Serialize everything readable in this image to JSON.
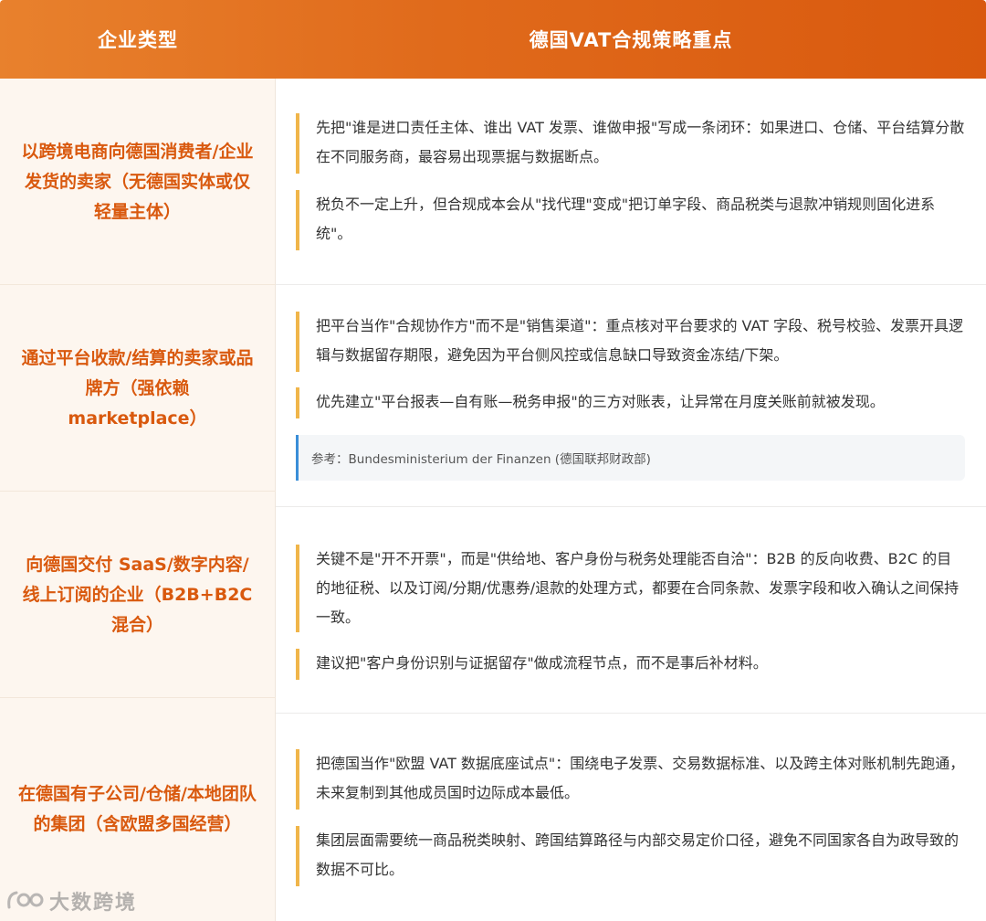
{
  "header": {
    "col1": "企业类型",
    "col2": "德国VAT合规策略重点"
  },
  "rows": [
    {
      "type": "以跨境电商向德国消费者/企业发货的卖家（无德国实体或仅轻量主体）",
      "points": [
        "先把\"谁是进口责任主体、谁出 VAT 发票、谁做申报\"写成一条闭环：如果进口、仓储、平台结算分散在不同服务商，最容易出现票据与数据断点。",
        "税负不一定上升，但合规成本会从\"找代理\"变成\"把订单字段、商品税类与退款冲销规则固化进系统\"。"
      ]
    },
    {
      "type": "通过平台收款/结算的卖家或品牌方（强依赖 marketplace）",
      "points": [
        "把平台当作\"合规协作方\"而不是\"销售渠道\"：重点核对平台要求的 VAT 字段、税号校验、发票开具逻辑与数据留存期限，避免因为平台侧风控或信息缺口导致资金冻结/下架。",
        "优先建立\"平台报表—自有账—税务申报\"的三方对账表，让异常在月度关账前就被发现。"
      ],
      "reference": "参考：Bundesministerium der Finanzen (德国联邦财政部)"
    },
    {
      "type": "向德国交付 SaaS/数字内容/线上订阅的企业（B2B+B2C混合）",
      "points": [
        "关键不是\"开不开票\"，而是\"供给地、客户身份与税务处理能否自洽\"：B2B 的反向收费、B2C 的目的地征税、以及订阅/分期/优惠券/退款的处理方式，都要在合同条款、发票字段和收入确认之间保持一致。",
        "建议把\"客户身份识别与证据留存\"做成流程节点，而不是事后补材料。"
      ]
    },
    {
      "type": "在德国有子公司/仓储/本地团队的集团（含欧盟多国经营）",
      "points": [
        "把德国当作\"欧盟 VAT 数据底座试点\"：围绕电子发票、交易数据标准、以及跨主体对账机制先跑通，未来复制到其他成员国时边际成本最低。",
        "集团层面需要统一商品税类映射、跨国结算路径与内部交易定价口径，避免不同国家各自为政导致的数据不可比。"
      ]
    }
  ],
  "watermark": {
    "text": "大数跨境",
    "icon": "logo-icon"
  }
}
